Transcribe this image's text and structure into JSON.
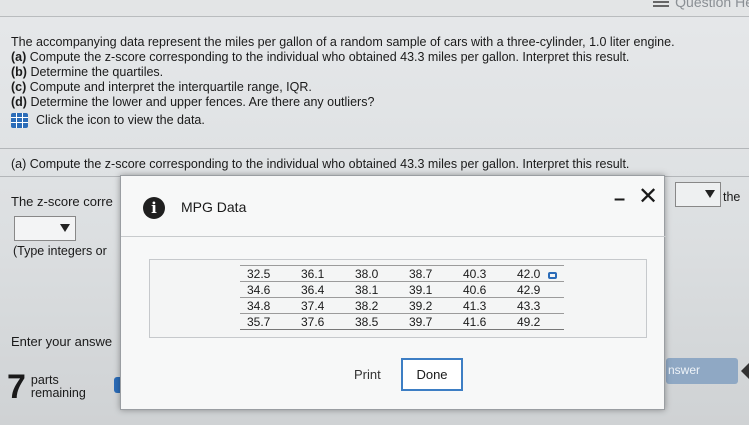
{
  "topbar": {
    "label": "Question He"
  },
  "question": {
    "intro": "The accompanying data represent the miles per gallon of a random sample of cars with a three-cylinder, 1.0 liter engine.",
    "parts": [
      {
        "tag": "(a)",
        "text": "Compute the z-score corresponding to the individual who obtained 43.3 miles per gallon. Interpret this result."
      },
      {
        "tag": "(b)",
        "text": "Determine the quartiles."
      },
      {
        "tag": "(c)",
        "text": "Compute and interpret the interquartile range, IQR."
      },
      {
        "tag": "(d)",
        "text": "Determine the lower and upper fences. Are there any outliers?"
      }
    ],
    "data_link": "Click the icon to view the data."
  },
  "part_a": {
    "heading": "(a) Compute the z-score corresponding to the individual who obtained 43.3 miles per gallon. Interpret this result.",
    "zscore_label": "The z-score corre",
    "type_hint": "(Type integers or",
    "right_text": "the"
  },
  "footer": {
    "enter_answer": "Enter your answe",
    "parts_num": "7",
    "parts_label_1": "parts",
    "parts_label_2": "remaining",
    "check_label": "nswer"
  },
  "modal": {
    "title": "MPG Data",
    "minimize": "–",
    "close": "✕",
    "table": [
      [
        "32.5",
        "36.1",
        "38.0",
        "38.7",
        "40.3",
        "42.0"
      ],
      [
        "34.6",
        "36.4",
        "38.1",
        "39.1",
        "40.6",
        "42.9"
      ],
      [
        "34.8",
        "37.4",
        "38.2",
        "39.2",
        "41.3",
        "43.3"
      ],
      [
        "35.7",
        "37.6",
        "38.5",
        "39.7",
        "41.6",
        "49.2"
      ]
    ],
    "print_label": "Print",
    "done_label": "Done"
  }
}
